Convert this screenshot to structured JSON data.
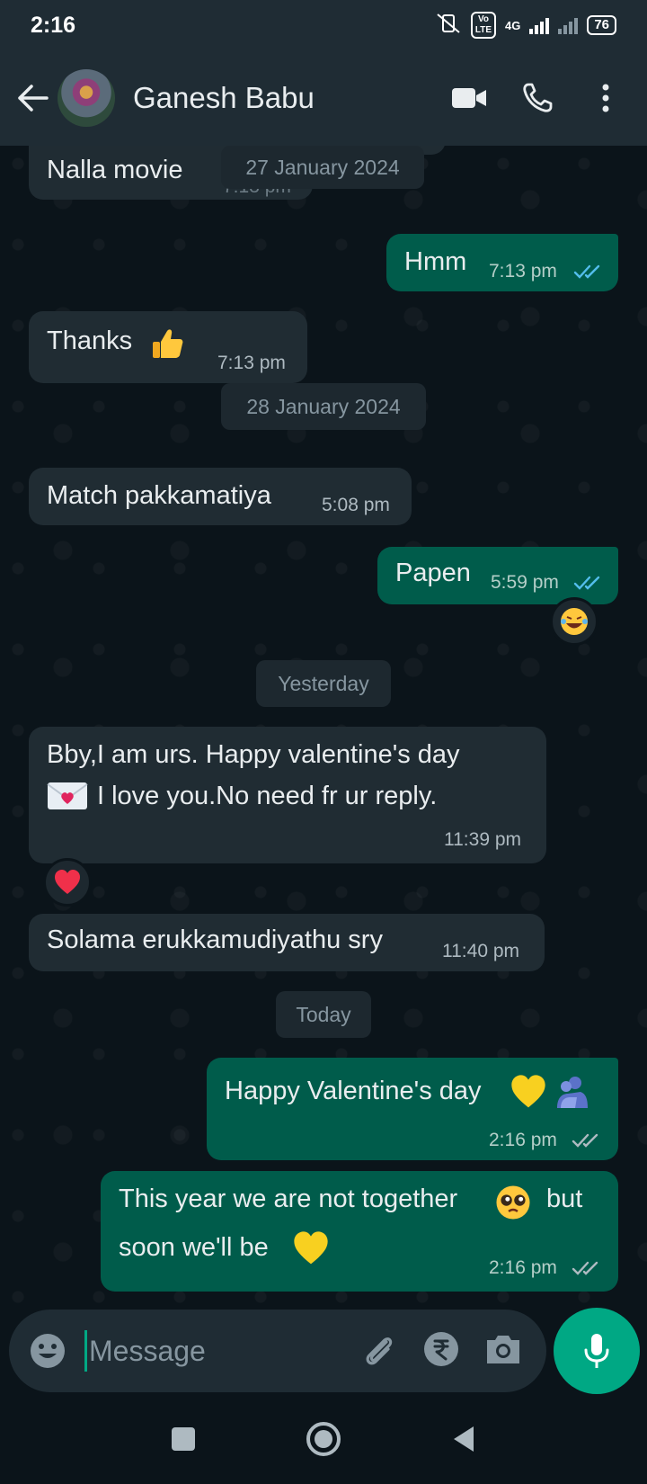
{
  "status": {
    "time": "2:16",
    "network": "4G",
    "battery": "76",
    "lte": "Vo LTE"
  },
  "header": {
    "contact_name": "Ganesh Babu"
  },
  "chat": {
    "partial_top": {
      "text": "Nalla movie",
      "time": "7:13 pm"
    },
    "chips": {
      "c1": "27 January 2024",
      "c2": "28 January 2024",
      "c3": "Yesterday",
      "c4": "Today"
    },
    "messages": {
      "m1": {
        "text": "Hmm",
        "time": "7:13 pm"
      },
      "m2": {
        "text": "Thanks",
        "time": "7:13 pm"
      },
      "m3": {
        "text": "Match pakkamatiya",
        "time": "5:08 pm"
      },
      "m4": {
        "text": "Papen",
        "time": "5:59 pm"
      },
      "m5": {
        "line1": "Bby,I am urs. Happy valentine's day",
        "line2": "I love you.No need fr ur reply.",
        "time": "11:39 pm"
      },
      "m6": {
        "text": "Solama erukkamudiyathu sry",
        "time": "11:40 pm"
      },
      "m7": {
        "text": "Happy Valentine's day",
        "time": "2:16 pm"
      },
      "m8": {
        "line1": "This year we are not together",
        "line1b": "but",
        "line2": "soon we'll be",
        "time": "2:16 pm"
      }
    }
  },
  "composer": {
    "placeholder": "Message"
  },
  "colors": {
    "incoming": "#202c33",
    "outgoing": "#005c4b",
    "accent": "#00a884",
    "read_tick": "#53bdeb"
  }
}
